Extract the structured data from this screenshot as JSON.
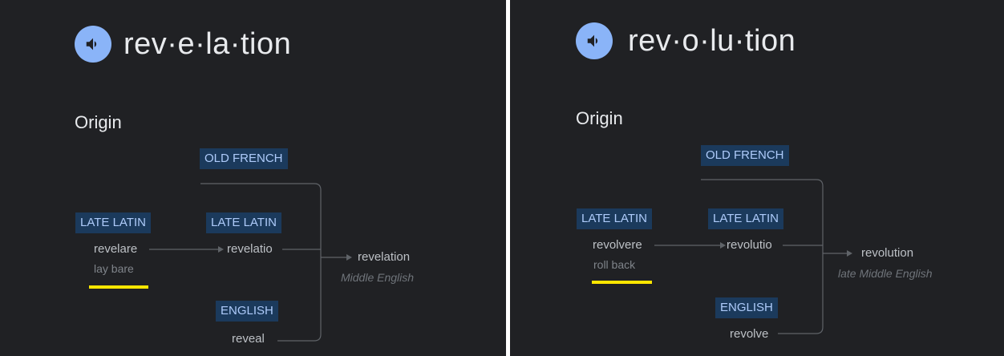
{
  "left": {
    "headword": "rev·e·la·tion",
    "origin_heading": "Origin",
    "tags": {
      "old_french": "OLD FRENCH",
      "late_latin_source": "LATE LATIN",
      "late_latin_mid": "LATE LATIN",
      "english": "ENGLISH"
    },
    "source_term": "revelare",
    "source_gloss": "lay bare",
    "mid_term": "revelatio",
    "english_term": "reveal",
    "result_word": "revelation",
    "result_language": "Middle English"
  },
  "right": {
    "headword": "rev·o·lu·tion",
    "origin_heading": "Origin",
    "tags": {
      "old_french": "OLD FRENCH",
      "late_latin_source": "LATE LATIN",
      "late_latin_mid": "LATE LATIN",
      "english": "ENGLISH"
    },
    "source_term": "revolvere",
    "source_gloss": "roll back",
    "mid_term": "revolutio",
    "english_term": "revolve",
    "result_word": "revolution",
    "result_language": "late Middle English"
  },
  "colors": {
    "background": "#202124",
    "speaker_button": "#8ab4f8",
    "tag_background": "#1b3a5c",
    "tag_text": "#aecbfa",
    "highlight_underline": "#ffe600"
  },
  "icons": {
    "speaker": "volume-up-icon",
    "arrow": "arrow-right-icon"
  }
}
